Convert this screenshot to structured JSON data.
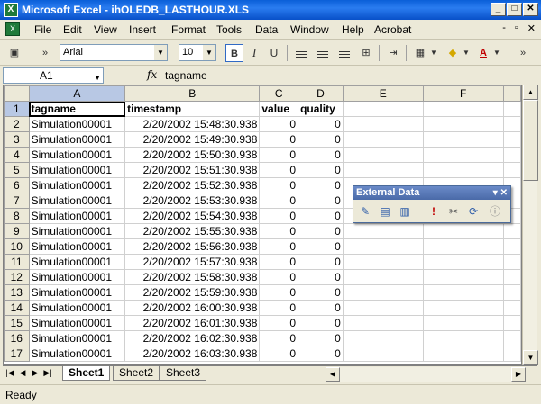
{
  "window": {
    "title": "Microsoft Excel - ihOLEDB_LASTHOUR.XLS",
    "app_icon": "X"
  },
  "menu": {
    "items": [
      "File",
      "Edit",
      "View",
      "Insert",
      "Format",
      "Tools",
      "Data",
      "Window",
      "Help",
      "Acrobat"
    ]
  },
  "toolbar": {
    "font_name": "Arial",
    "font_size": "10",
    "bold_label": "B",
    "italic_label": "I",
    "underline_label": "U"
  },
  "formula": {
    "cell_ref": "A1",
    "fx_label": "fx",
    "value": "tagname"
  },
  "sheet": {
    "columns": [
      "A",
      "B",
      "C",
      "D",
      "E",
      "F"
    ],
    "header_row": [
      "tagname",
      "timestamp",
      "value",
      "quality"
    ],
    "rows": [
      [
        "Simulation00001",
        "2/20/2002 15:48:30.938",
        "0",
        "0"
      ],
      [
        "Simulation00001",
        "2/20/2002 15:49:30.938",
        "0",
        "0"
      ],
      [
        "Simulation00001",
        "2/20/2002 15:50:30.938",
        "0",
        "0"
      ],
      [
        "Simulation00001",
        "2/20/2002 15:51:30.938",
        "0",
        "0"
      ],
      [
        "Simulation00001",
        "2/20/2002 15:52:30.938",
        "0",
        "0"
      ],
      [
        "Simulation00001",
        "2/20/2002 15:53:30.938",
        "0",
        "0"
      ],
      [
        "Simulation00001",
        "2/20/2002 15:54:30.938",
        "0",
        "0"
      ],
      [
        "Simulation00001",
        "2/20/2002 15:55:30.938",
        "0",
        "0"
      ],
      [
        "Simulation00001",
        "2/20/2002 15:56:30.938",
        "0",
        "0"
      ],
      [
        "Simulation00001",
        "2/20/2002 15:57:30.938",
        "0",
        "0"
      ],
      [
        "Simulation00001",
        "2/20/2002 15:58:30.938",
        "0",
        "0"
      ],
      [
        "Simulation00001",
        "2/20/2002 15:59:30.938",
        "0",
        "0"
      ],
      [
        "Simulation00001",
        "2/20/2002 16:00:30.938",
        "0",
        "0"
      ],
      [
        "Simulation00001",
        "2/20/2002 16:01:30.938",
        "0",
        "0"
      ],
      [
        "Simulation00001",
        "2/20/2002 16:02:30.938",
        "0",
        "0"
      ],
      [
        "Simulation00001",
        "2/20/2002 16:03:30.938",
        "0",
        "0"
      ]
    ]
  },
  "tabs": [
    "Sheet1",
    "Sheet2",
    "Sheet3"
  ],
  "status": {
    "text": "Ready"
  },
  "external_data": {
    "title": "External Data"
  },
  "colors": {
    "titlebar": "#0a5fd8",
    "selection_header": "#b8c8e4"
  }
}
